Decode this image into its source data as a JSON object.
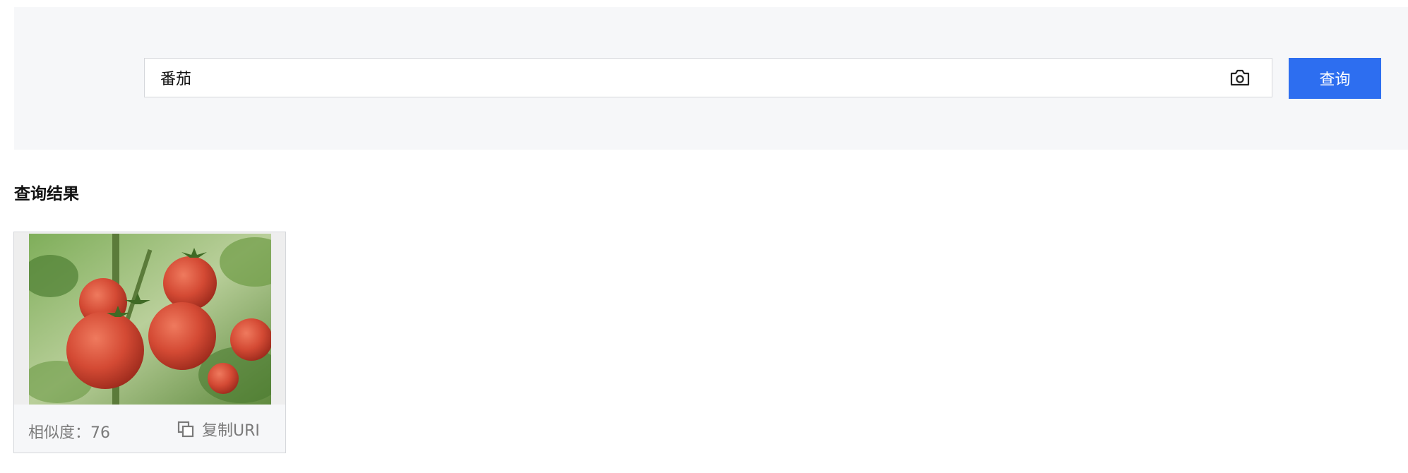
{
  "search": {
    "value": "番茄",
    "button_label": "查询",
    "icon": "camera-icon"
  },
  "results": {
    "title": "查询结果",
    "items": [
      {
        "image_description": "red tomatoes on vine",
        "similarity_label": "相似度：",
        "similarity_value": "76",
        "copy_label": "复制URI",
        "copy_icon": "copy-icon"
      }
    ]
  },
  "colors": {
    "primary": "#2d6ef0",
    "panel_bg": "#f6f7f9",
    "border": "#d5d7db",
    "muted_text": "#7a7a7a"
  }
}
